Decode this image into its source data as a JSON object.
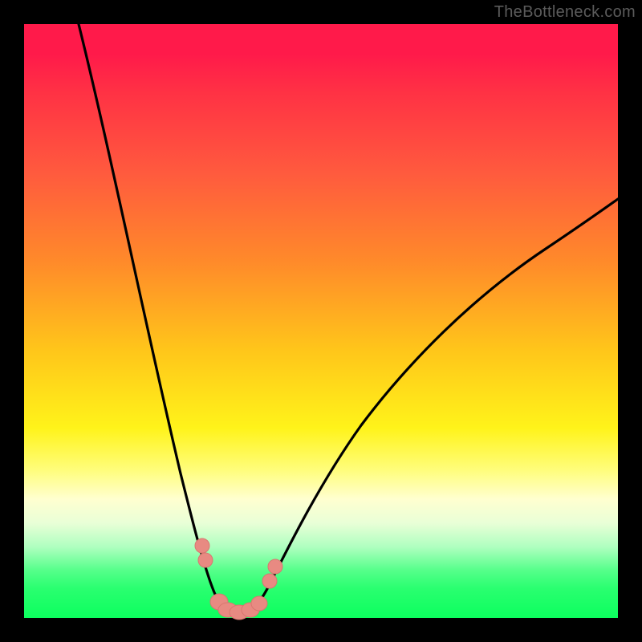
{
  "watermark": "TheBottleneck.com",
  "colors": {
    "frame": "#000000",
    "curve": "#000000",
    "marker": "#e88a82",
    "watermark_text": "#5b5b5b"
  },
  "chart_data": {
    "type": "line",
    "title": "",
    "xlabel": "",
    "ylabel": "",
    "xlim": [
      0,
      100
    ],
    "ylim": [
      0,
      100
    ],
    "annotations": [
      "TheBottleneck.com"
    ],
    "curve_note": "V-shaped bottleneck curve; y is percentage bottleneck, minimum near x≈34 at y≈0. Left branch starts at roughly (9,100) descending steeply; right branch rises to roughly (100,60).",
    "x": [
      9,
      12,
      15,
      18,
      21,
      24,
      27,
      29,
      31,
      33,
      34,
      35,
      36,
      38,
      40,
      45,
      50,
      55,
      60,
      65,
      70,
      75,
      80,
      85,
      90,
      95,
      100
    ],
    "y": [
      100,
      90,
      78,
      66,
      54,
      42,
      30,
      20,
      12,
      5,
      1,
      0,
      1,
      3,
      6,
      13,
      20,
      26,
      31,
      36,
      41,
      45,
      49,
      52,
      55,
      58,
      60
    ],
    "markers": {
      "note": "highlighted salmon marker points near the minimum",
      "x": [
        29,
        29.5,
        31,
        32,
        34,
        35,
        36,
        37,
        38.5,
        39.5
      ],
      "y": [
        14,
        11,
        5,
        2,
        0.5,
        0.5,
        1,
        2,
        6,
        9
      ]
    }
  }
}
